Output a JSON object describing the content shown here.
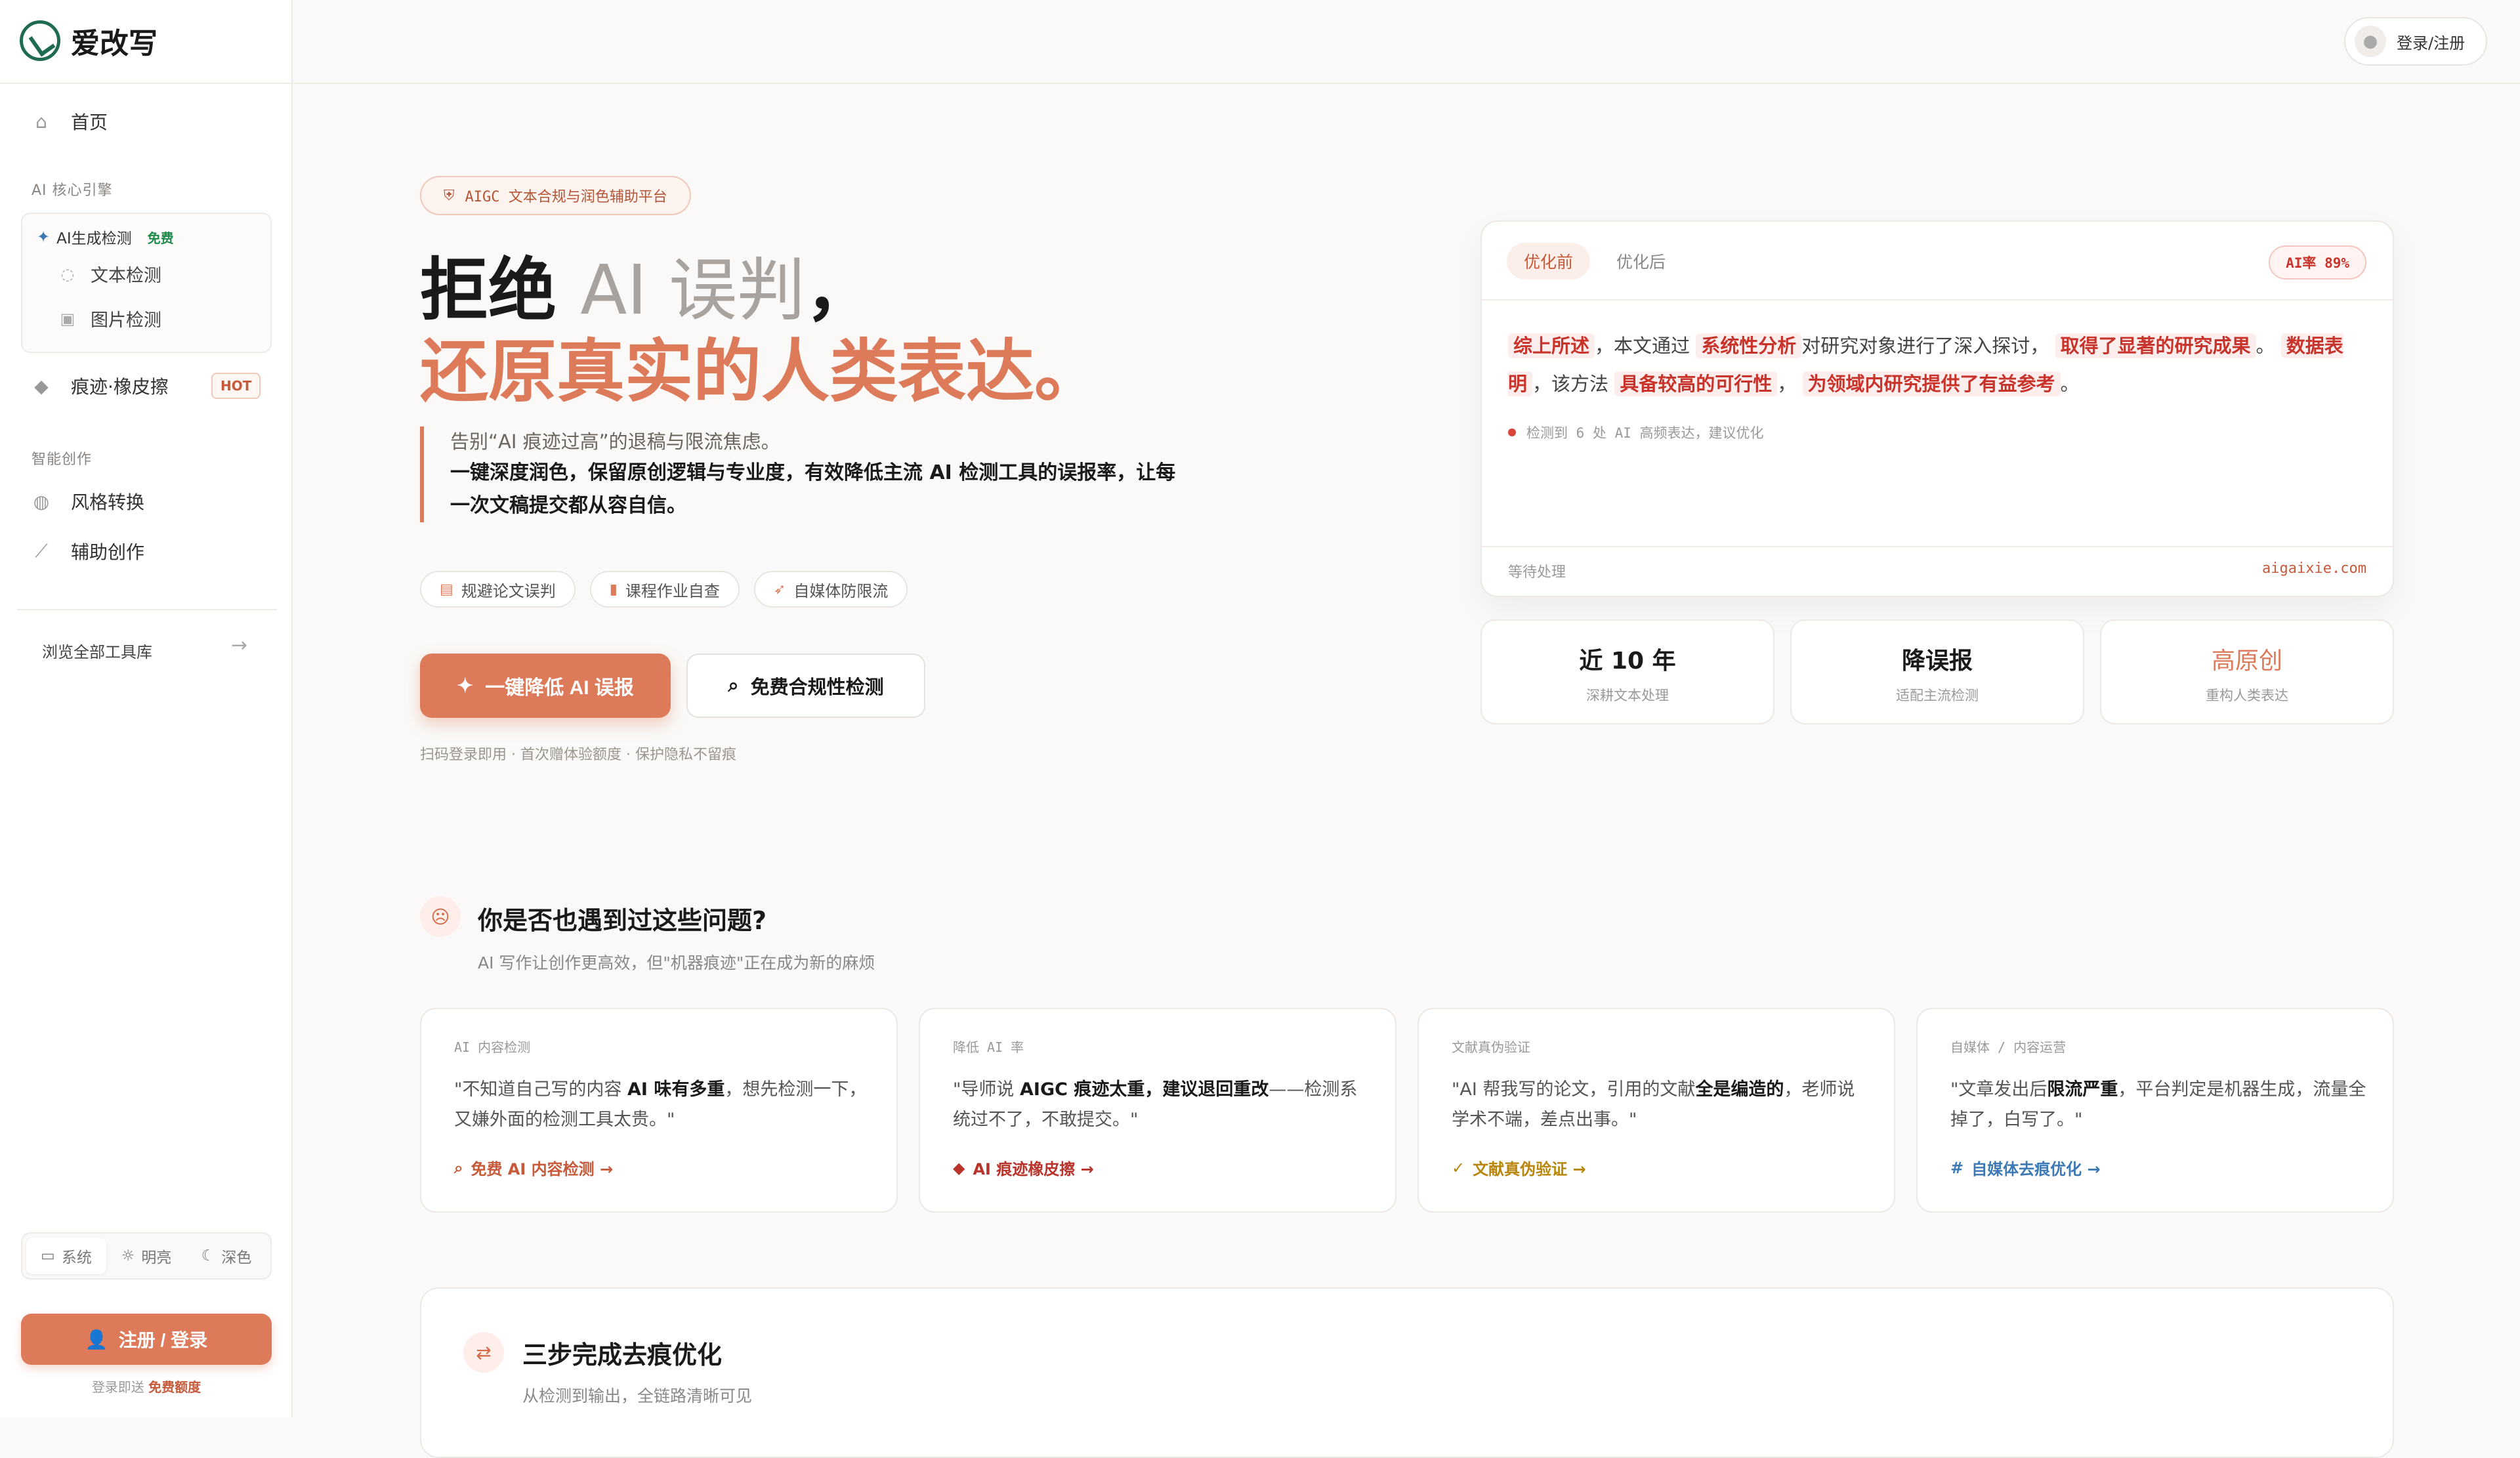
{
  "brand": {
    "name": "爱改写"
  },
  "sidebar": {
    "home": "首页",
    "section_ai": "AI 核心引擎",
    "group_title": "AI生成检测",
    "group_badge": "免费",
    "sub_text": "文本检测",
    "sub_image": "图片检测",
    "eraser": "痕迹·橡皮擦",
    "eraser_badge": "HOT",
    "section_create": "智能创作",
    "style": "风格转换",
    "assist": "辅助创作",
    "browse": "浏览全部工具库",
    "themes": [
      "系统",
      "明亮",
      "深色"
    ],
    "login_button": "注册 / 登录",
    "login_note_prefix": "登录即送",
    "login_note_highlight": "免费额度"
  },
  "topbar": {
    "login": "登录/注册"
  },
  "hero": {
    "pill": "AIGC 文本合规与润色辅助平台",
    "title_dark": "拒绝",
    "title_gray": "AI 误判",
    "title_comma": "，",
    "title_line2": "还原真实的人类表达。",
    "desc_line1": "告别“AI 痕迹过高”的退稿与限流焦虑。",
    "desc_line2": "一键深度润色，保留原创逻辑与专业度，有效降低主流 AI 检测工具的误报率，让每一次文稿提交都从容自信。",
    "chips": [
      "规避论文误判",
      "课程作业自查",
      "自媒体防限流"
    ],
    "primary_button": "一键降低 AI 误报",
    "secondary_button": "免费合规性检测",
    "note": "扫码登录即用 · 首次赠体验额度 · 保护隐私不留痕"
  },
  "compare": {
    "tab_before": "优化前",
    "tab_after": "优化后",
    "ai_rate": "AI率 89%",
    "seg": [
      "综上所述",
      "，本文通过",
      "系统性分析",
      "对研究对象进行了深入探讨，",
      "取得了显著的研究成果",
      "。",
      "数据表明",
      "，该方法",
      "具备较高的可行性",
      "，",
      "为领域内研究提供了有益参考",
      "。"
    ],
    "status": "检测到 6 处 AI 高频表达，建议优化",
    "wait": "等待处理",
    "domain": "aigaixie.com"
  },
  "stats": [
    {
      "value": "近 10 年",
      "sub": "深耕文本处理"
    },
    {
      "value": "降误报",
      "sub": "适配主流检测"
    },
    {
      "value": "高原创",
      "sub": "重构人类表达"
    }
  ],
  "problems": {
    "title": "你是否也遇到过这些问题?",
    "subtitle": "AI 写作让创作更高效，但\"机器痕迹\"正在成为新的麻烦",
    "cards": [
      {
        "tag": "AI 内容检测",
        "q1": "\"不知道自己写的内容 ",
        "qb": "AI 味有多重",
        "q2": "，想先检测一下，又嫌外面的检测工具太贵。\"",
        "link": "免费 AI 内容检测 →"
      },
      {
        "tag": "降低 AI 率",
        "q1": "\"导师说 ",
        "qb": "AIGC 痕迹太重，建议退回重改",
        "q2": "——检测系统过不了，不敢提交。\"",
        "link": "AI 痕迹橡皮擦 →"
      },
      {
        "tag": "文献真伪验证",
        "q1": "\"AI 帮我写的论文，引用的文献",
        "qb": "全是编造的",
        "q2": "，老师说学术不端，差点出事。\"",
        "link": "文献真伪验证 →"
      },
      {
        "tag": "自媒体 / 内容运营",
        "q1": "\"文章发出后",
        "qb": "限流严重",
        "q2": "，平台判定是机器生成，流量全掉了，白写了。\"",
        "link": "自媒体去痕优化 →"
      }
    ]
  },
  "steps": {
    "title": "三步完成去痕优化",
    "subtitle": "从检测到输出，全链路清晰可见"
  }
}
